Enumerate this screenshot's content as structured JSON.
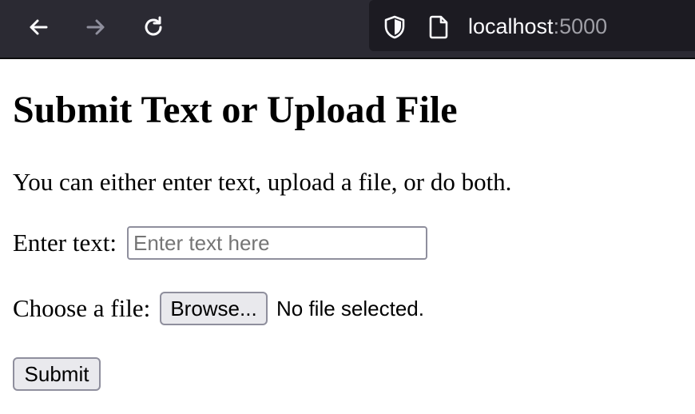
{
  "browser": {
    "url_host": "localhost",
    "url_port": ":5000",
    "icons": [
      "back-arrow-icon",
      "forward-arrow-icon",
      "reload-icon",
      "shield-icon",
      "page-icon"
    ],
    "colors": {
      "toolbar_bg": "#2b2a33",
      "urlbar_bg": "#1c1b22",
      "icon_active": "#fbfbfe",
      "icon_disabled": "#8f8f9d"
    }
  },
  "page": {
    "title": "Submit Text or Upload File",
    "intro": "You can either enter text, upload a file, or do both.",
    "text_field": {
      "label": "Enter text:",
      "placeholder": "Enter text here",
      "value": ""
    },
    "file_field": {
      "label": "Choose a file:",
      "browse_label": "Browse...",
      "status": "No file selected."
    },
    "submit_label": "Submit"
  }
}
